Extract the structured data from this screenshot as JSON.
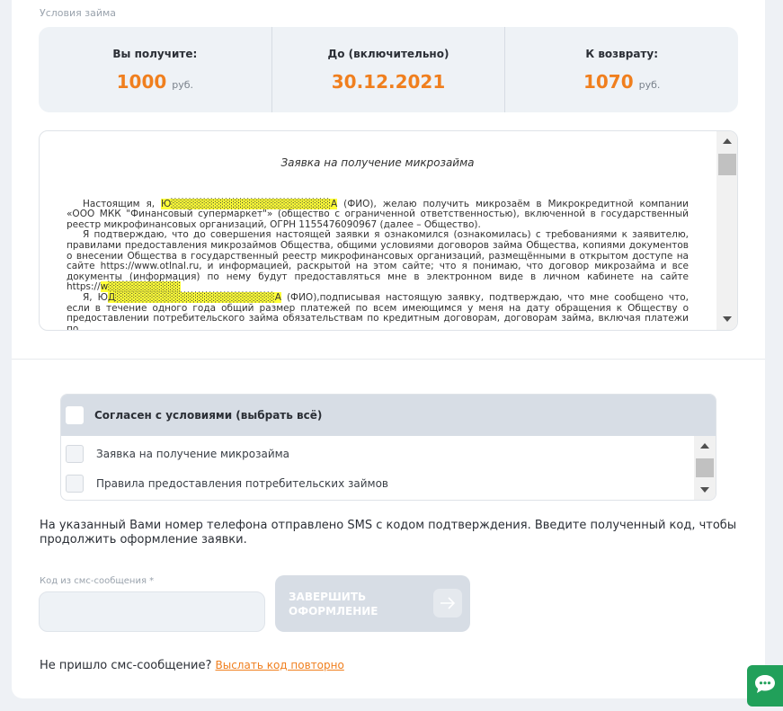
{
  "section_label": "Условия займа",
  "terms": [
    {
      "label": "Вы получите:",
      "value": "1000",
      "unit": "руб."
    },
    {
      "label": "До (включительно)",
      "value": "30.12.2021",
      "unit": ""
    },
    {
      "label": "К возврату:",
      "value": "1070",
      "unit": "руб."
    }
  ],
  "document": {
    "title": "Заявка на получение микрозайма",
    "p1_a": "Настоящим я, ",
    "p1_hl": "Ю░░░░░░░░░░░░░░░░░░░░░░А",
    "p1_b": " (ФИО), желаю получить микрозаём в Микрокредитной компании «ООО МКК \"Финансовый супермаркет\"» (общество с ограниченной ответственностью), включенной в государственный реестр микрофинансовых организаций, ОГРН 1155476090967 (далее – Общество).",
    "p2_a": "Я подтверждаю, что до совершения настоящей заявки я ознакомился (ознакомилась) с требованиями к заявителю, правилами предоставления микрозаймов Общества, общими условиями договоров займа Общества, копиями документов о внесении Общества в государственный реестр микрофинансовых организаций, размещёнными в открытом доступе на сайте https://www.otlnal.ru, и информацией, раскрытой на этом сайте; что я понимаю, что договор микрозайма и все документы (информация) по нему будут предоставляться мне в электронном виде в личном кабинете на сайте https://",
    "p2_hl": "w░░░░░░░░░░",
    "p3_a": "Я, Ю",
    "p3_hl": "Д░░░░░░░░░░░░░░░░░░░░░░А",
    "p3_b": " (ФИО),подписывая настоящую заявку, подтверждаю, что мне сообщено что, если в течение одного года общий размер платежей по всем имеющимся у меня на дату обращения к Обществу о предоставлении потребительского займа обязательствам по кредитным договорам, договорам займа, включая платежи по"
  },
  "agreement": {
    "all_label": "Согласен с условиями (выбрать всё)",
    "items": [
      {
        "label": "Заявка на получение микрозайма"
      },
      {
        "label": "Правила предоставления потребительских займов"
      }
    ]
  },
  "sms_note": "На указанный Вами номер телефона отправлено SMS с кодом подтверждения. Введите полученный код, чтобы продолжить оформление заявки.",
  "code_field": {
    "label": "Код из смс-сообщения *",
    "value": ""
  },
  "submit_label": "Завершить оформление",
  "resend": {
    "text": "Не пришло смс-сообщение?",
    "link": "Выслать код повторно"
  },
  "colors": {
    "accent": "#f07f1e",
    "highlight": "#ffff38",
    "chat": "#21a05a"
  },
  "icons": {
    "submit": "arrow-right-icon",
    "chat": "chat-bubble-icon"
  }
}
